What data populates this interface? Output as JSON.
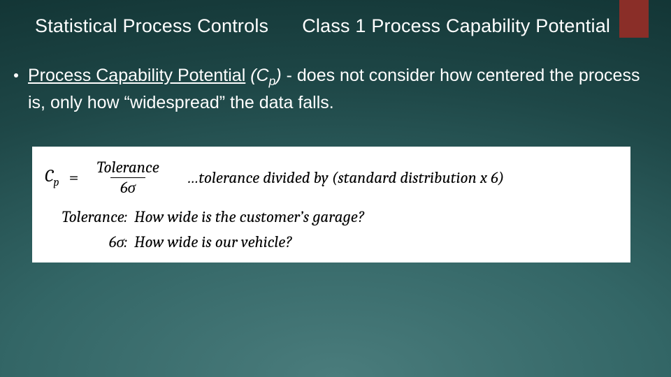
{
  "header": {
    "left": "Statistical Process Controls",
    "right": "Class 1   Process Capability Potential"
  },
  "bullet": {
    "term": "Process Capability Potential",
    "symbol_prefix": " (C",
    "symbol_sub": "p",
    "symbol_suffix": ")",
    "rest": " - does not consider how centered the process is, only how “widespread” the data falls."
  },
  "formula": {
    "lhs_prefix": "C",
    "lhs_sub": "p",
    "eq": "=",
    "numerator": "Tolerance",
    "denominator": "6σ",
    "description": "…tolerance divided by (standard distribution x 6)"
  },
  "defs": {
    "tolerance_label": "Tolerance:",
    "tolerance_text": "How wide is the customer’s garage?",
    "sixsigma_label": "6σ:",
    "sixsigma_text": "How wide is our vehicle?"
  }
}
